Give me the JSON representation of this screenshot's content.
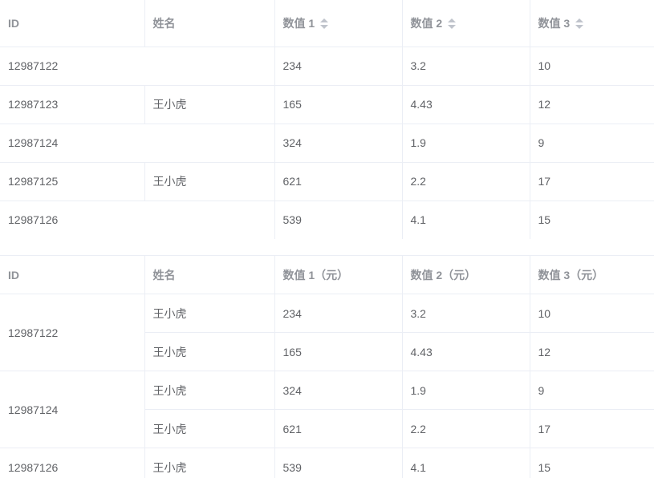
{
  "table1": {
    "headers": [
      "ID",
      "姓名",
      "数值 1",
      "数值 2",
      "数值 3"
    ],
    "rows": [
      {
        "id": "12987122",
        "name": "",
        "v1": "234",
        "v2": "3.2",
        "v3": "10"
      },
      {
        "id": "12987123",
        "name": "王小虎",
        "v1": "165",
        "v2": "4.43",
        "v3": "12"
      },
      {
        "id": "12987124",
        "name": "",
        "v1": "324",
        "v2": "1.9",
        "v3": "9"
      },
      {
        "id": "12987125",
        "name": "王小虎",
        "v1": "621",
        "v2": "2.2",
        "v3": "17"
      },
      {
        "id": "12987126",
        "name": "",
        "v1": "539",
        "v2": "4.1",
        "v3": "15"
      }
    ]
  },
  "table2": {
    "headers": [
      "ID",
      "姓名",
      "数值 1（元）",
      "数值 2（元）",
      "数值 3（元）"
    ],
    "rows": [
      {
        "id": "12987122",
        "name": "王小虎",
        "v1": "234",
        "v2": "3.2",
        "v3": "10"
      },
      {
        "id": "",
        "name": "王小虎",
        "v1": "165",
        "v2": "4.43",
        "v3": "12"
      },
      {
        "id": "12987124",
        "name": "王小虎",
        "v1": "324",
        "v2": "1.9",
        "v3": "9"
      },
      {
        "id": "",
        "name": "王小虎",
        "v1": "621",
        "v2": "2.2",
        "v3": "17"
      },
      {
        "id": "12987126",
        "name": "王小虎",
        "v1": "539",
        "v2": "4.1",
        "v3": "15"
      }
    ]
  },
  "icons": {
    "sort": "sort-caret-icon"
  },
  "colors": {
    "header_text": "#909399",
    "cell_text": "#606266",
    "border": "#ebeef5",
    "caret": "#c0c4cc"
  }
}
